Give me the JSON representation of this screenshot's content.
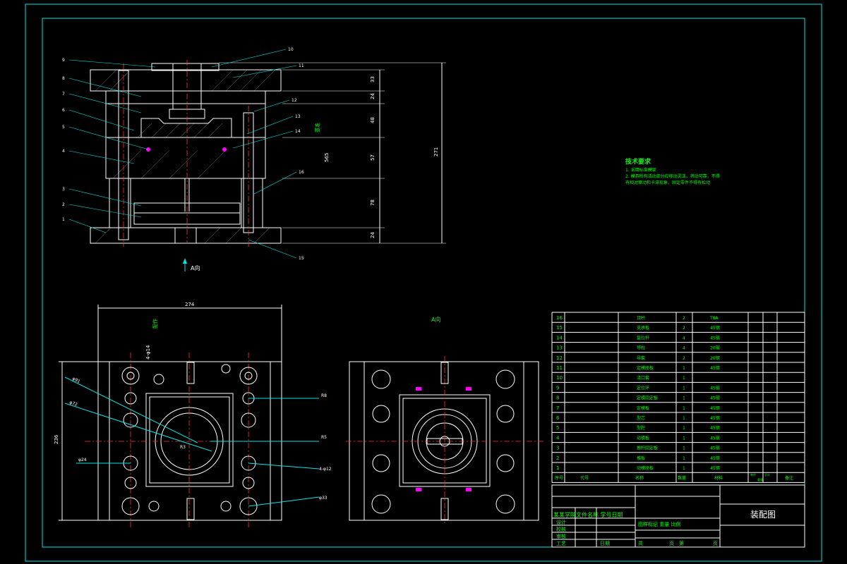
{
  "drawing": {
    "title": "装配图",
    "view_label_top": "A向",
    "view_label_bottom": "A向",
    "colors": {
      "background": "#000000",
      "frame": "#00e5e5",
      "outline": "#ffffff",
      "center": "#ff3030",
      "text": "#00ff00",
      "marker": "#ff00ff"
    }
  },
  "section_view": {
    "part_callouts": [
      "1",
      "2",
      "3",
      "4",
      "5",
      "6",
      "7",
      "8",
      "9",
      "10",
      "11",
      "12",
      "13",
      "14",
      "15",
      "16"
    ],
    "vertical_dims": [
      "33",
      "24",
      "48",
      "57",
      "78",
      "24"
    ],
    "overall_height": "271",
    "side_label": "基准",
    "side_label_2": "565"
  },
  "tech_requirements": {
    "heading": "技术要求",
    "lines": [
      "1. 采用标准模架",
      "2. 模具所有活动部分应移动灵活，将动可靠，不得",
      "有相对窜动和卡滞现象，固定零件不得有松动"
    ]
  },
  "plan_view": {
    "overall_width": "274",
    "overall_height": "236",
    "dims": [
      "4-φ14",
      "φ91",
      "φ72",
      "R3",
      "φ24",
      "R8",
      "R5",
      "4-φ12",
      "φ33",
      "配作"
    ]
  },
  "parts_list": {
    "header": {
      "no": "序号",
      "code": "代号",
      "name": "名称",
      "qty": "数量",
      "material": "材料",
      "weight_single": "单件",
      "weight_total": "总计",
      "weight": "重量",
      "remark": "备注"
    },
    "rows": [
      {
        "no": "16",
        "name": "顶杆",
        "qty": "2",
        "material": "T8A"
      },
      {
        "no": "15",
        "name": "支承板",
        "qty": "2",
        "material": "45钢"
      },
      {
        "no": "14",
        "name": "复位杆",
        "qty": "4",
        "material": "45钢"
      },
      {
        "no": "13",
        "name": "导柱",
        "qty": "4",
        "material": "20钢"
      },
      {
        "no": "12",
        "name": "导套",
        "qty": "2",
        "material": "20钢"
      },
      {
        "no": "11",
        "name": "定模座板",
        "qty": "1",
        "material": "45钢"
      },
      {
        "no": "10",
        "name": "浇口套",
        "qty": "1",
        "material": ""
      },
      {
        "no": "9",
        "name": "定位环",
        "qty": "1",
        "material": "45钢"
      },
      {
        "no": "8",
        "name": "定模固定板",
        "qty": "1",
        "material": "45钢"
      },
      {
        "no": "7",
        "name": "定模板",
        "qty": "1",
        "material": "45钢"
      },
      {
        "no": "6",
        "name": "型芯",
        "qty": "1",
        "material": "45钢"
      },
      {
        "no": "5",
        "name": "型腔",
        "qty": "1",
        "material": "45钢"
      },
      {
        "no": "4",
        "name": "动模板",
        "qty": "1",
        "material": "45钢"
      },
      {
        "no": "3",
        "name": "推杆固定板",
        "qty": "1",
        "material": "45钢"
      },
      {
        "no": "2",
        "name": "推板",
        "qty": "1",
        "material": "45钢"
      },
      {
        "no": "1",
        "name": "动模座板",
        "qty": "1",
        "material": "45钢"
      }
    ]
  },
  "title_block": {
    "school": "某某学院文件名称  学号日期",
    "design": "设计",
    "check": "校核",
    "review": "审核",
    "process": "工艺",
    "date": "日期",
    "stage_row": "图样标记  重量  比例",
    "sheet_total": "共",
    "sheet_unit": "页",
    "sheet_no": "第",
    "sheet_unit2": "页",
    "drawing_name": "装配图"
  }
}
